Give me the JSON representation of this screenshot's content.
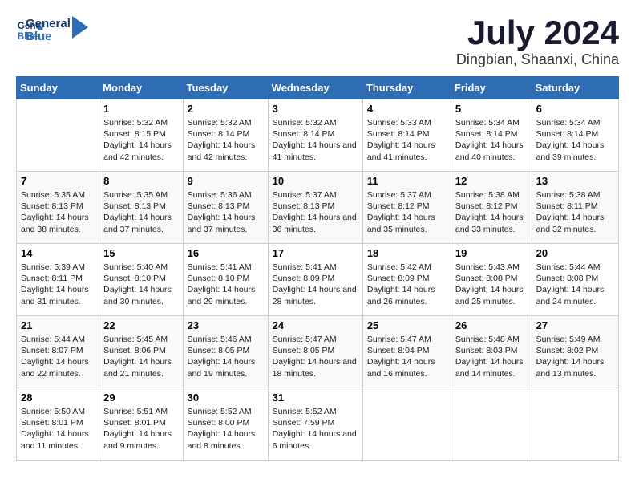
{
  "header": {
    "logo_line1": "General",
    "logo_line2": "Blue",
    "month_year": "July 2024",
    "location": "Dingbian, Shaanxi, China"
  },
  "weekdays": [
    "Sunday",
    "Monday",
    "Tuesday",
    "Wednesday",
    "Thursday",
    "Friday",
    "Saturday"
  ],
  "weeks": [
    [
      {
        "day": "",
        "sunrise": "",
        "sunset": "",
        "daylight": ""
      },
      {
        "day": "1",
        "sunrise": "Sunrise: 5:32 AM",
        "sunset": "Sunset: 8:15 PM",
        "daylight": "Daylight: 14 hours and 42 minutes."
      },
      {
        "day": "2",
        "sunrise": "Sunrise: 5:32 AM",
        "sunset": "Sunset: 8:14 PM",
        "daylight": "Daylight: 14 hours and 42 minutes."
      },
      {
        "day": "3",
        "sunrise": "Sunrise: 5:32 AM",
        "sunset": "Sunset: 8:14 PM",
        "daylight": "Daylight: 14 hours and 41 minutes."
      },
      {
        "day": "4",
        "sunrise": "Sunrise: 5:33 AM",
        "sunset": "Sunset: 8:14 PM",
        "daylight": "Daylight: 14 hours and 41 minutes."
      },
      {
        "day": "5",
        "sunrise": "Sunrise: 5:34 AM",
        "sunset": "Sunset: 8:14 PM",
        "daylight": "Daylight: 14 hours and 40 minutes."
      },
      {
        "day": "6",
        "sunrise": "Sunrise: 5:34 AM",
        "sunset": "Sunset: 8:14 PM",
        "daylight": "Daylight: 14 hours and 39 minutes."
      }
    ],
    [
      {
        "day": "7",
        "sunrise": "Sunrise: 5:35 AM",
        "sunset": "Sunset: 8:13 PM",
        "daylight": "Daylight: 14 hours and 38 minutes."
      },
      {
        "day": "8",
        "sunrise": "Sunrise: 5:35 AM",
        "sunset": "Sunset: 8:13 PM",
        "daylight": "Daylight: 14 hours and 37 minutes."
      },
      {
        "day": "9",
        "sunrise": "Sunrise: 5:36 AM",
        "sunset": "Sunset: 8:13 PM",
        "daylight": "Daylight: 14 hours and 37 minutes."
      },
      {
        "day": "10",
        "sunrise": "Sunrise: 5:37 AM",
        "sunset": "Sunset: 8:13 PM",
        "daylight": "Daylight: 14 hours and 36 minutes."
      },
      {
        "day": "11",
        "sunrise": "Sunrise: 5:37 AM",
        "sunset": "Sunset: 8:12 PM",
        "daylight": "Daylight: 14 hours and 35 minutes."
      },
      {
        "day": "12",
        "sunrise": "Sunrise: 5:38 AM",
        "sunset": "Sunset: 8:12 PM",
        "daylight": "Daylight: 14 hours and 33 minutes."
      },
      {
        "day": "13",
        "sunrise": "Sunrise: 5:38 AM",
        "sunset": "Sunset: 8:11 PM",
        "daylight": "Daylight: 14 hours and 32 minutes."
      }
    ],
    [
      {
        "day": "14",
        "sunrise": "Sunrise: 5:39 AM",
        "sunset": "Sunset: 8:11 PM",
        "daylight": "Daylight: 14 hours and 31 minutes."
      },
      {
        "day": "15",
        "sunrise": "Sunrise: 5:40 AM",
        "sunset": "Sunset: 8:10 PM",
        "daylight": "Daylight: 14 hours and 30 minutes."
      },
      {
        "day": "16",
        "sunrise": "Sunrise: 5:41 AM",
        "sunset": "Sunset: 8:10 PM",
        "daylight": "Daylight: 14 hours and 29 minutes."
      },
      {
        "day": "17",
        "sunrise": "Sunrise: 5:41 AM",
        "sunset": "Sunset: 8:09 PM",
        "daylight": "Daylight: 14 hours and 28 minutes."
      },
      {
        "day": "18",
        "sunrise": "Sunrise: 5:42 AM",
        "sunset": "Sunset: 8:09 PM",
        "daylight": "Daylight: 14 hours and 26 minutes."
      },
      {
        "day": "19",
        "sunrise": "Sunrise: 5:43 AM",
        "sunset": "Sunset: 8:08 PM",
        "daylight": "Daylight: 14 hours and 25 minutes."
      },
      {
        "day": "20",
        "sunrise": "Sunrise: 5:44 AM",
        "sunset": "Sunset: 8:08 PM",
        "daylight": "Daylight: 14 hours and 24 minutes."
      }
    ],
    [
      {
        "day": "21",
        "sunrise": "Sunrise: 5:44 AM",
        "sunset": "Sunset: 8:07 PM",
        "daylight": "Daylight: 14 hours and 22 minutes."
      },
      {
        "day": "22",
        "sunrise": "Sunrise: 5:45 AM",
        "sunset": "Sunset: 8:06 PM",
        "daylight": "Daylight: 14 hours and 21 minutes."
      },
      {
        "day": "23",
        "sunrise": "Sunrise: 5:46 AM",
        "sunset": "Sunset: 8:05 PM",
        "daylight": "Daylight: 14 hours and 19 minutes."
      },
      {
        "day": "24",
        "sunrise": "Sunrise: 5:47 AM",
        "sunset": "Sunset: 8:05 PM",
        "daylight": "Daylight: 14 hours and 18 minutes."
      },
      {
        "day": "25",
        "sunrise": "Sunrise: 5:47 AM",
        "sunset": "Sunset: 8:04 PM",
        "daylight": "Daylight: 14 hours and 16 minutes."
      },
      {
        "day": "26",
        "sunrise": "Sunrise: 5:48 AM",
        "sunset": "Sunset: 8:03 PM",
        "daylight": "Daylight: 14 hours and 14 minutes."
      },
      {
        "day": "27",
        "sunrise": "Sunrise: 5:49 AM",
        "sunset": "Sunset: 8:02 PM",
        "daylight": "Daylight: 14 hours and 13 minutes."
      }
    ],
    [
      {
        "day": "28",
        "sunrise": "Sunrise: 5:50 AM",
        "sunset": "Sunset: 8:01 PM",
        "daylight": "Daylight: 14 hours and 11 minutes."
      },
      {
        "day": "29",
        "sunrise": "Sunrise: 5:51 AM",
        "sunset": "Sunset: 8:01 PM",
        "daylight": "Daylight: 14 hours and 9 minutes."
      },
      {
        "day": "30",
        "sunrise": "Sunrise: 5:52 AM",
        "sunset": "Sunset: 8:00 PM",
        "daylight": "Daylight: 14 hours and 8 minutes."
      },
      {
        "day": "31",
        "sunrise": "Sunrise: 5:52 AM",
        "sunset": "Sunset: 7:59 PM",
        "daylight": "Daylight: 14 hours and 6 minutes."
      },
      {
        "day": "",
        "sunrise": "",
        "sunset": "",
        "daylight": ""
      },
      {
        "day": "",
        "sunrise": "",
        "sunset": "",
        "daylight": ""
      },
      {
        "day": "",
        "sunrise": "",
        "sunset": "",
        "daylight": ""
      }
    ]
  ]
}
